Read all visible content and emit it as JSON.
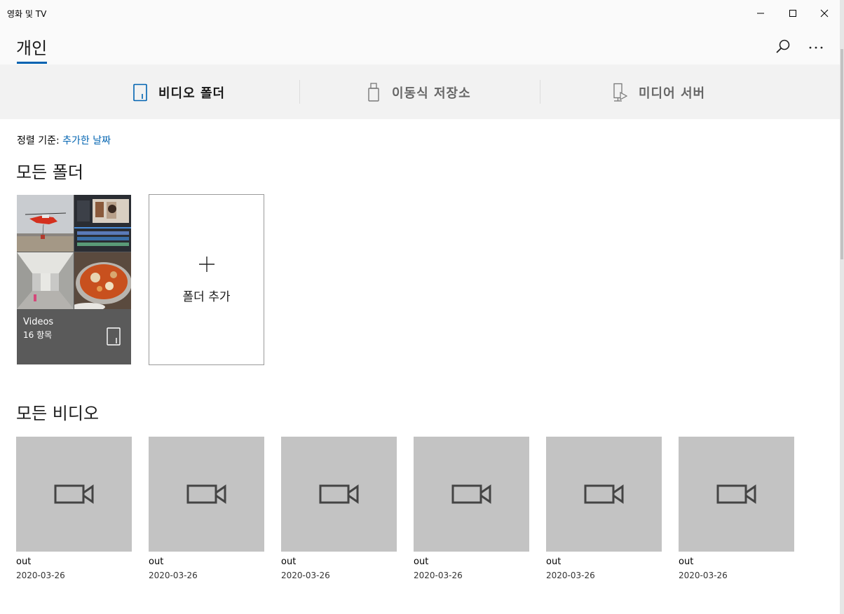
{
  "window": {
    "title": "영화 및 TV",
    "minimize_icon": "minimize-icon",
    "maximize_icon": "maximize-icon",
    "close_icon": "close-icon"
  },
  "header": {
    "title": "개인",
    "search_icon": "search-icon",
    "more_icon": "more-icon",
    "accent": "#0063b1"
  },
  "tabs": [
    {
      "label": "비디오 폴더",
      "icon": "video-folder-icon",
      "active": true
    },
    {
      "label": "이동식 저장소",
      "icon": "usb-drive-icon",
      "active": false
    },
    {
      "label": "미디어 서버",
      "icon": "media-server-icon",
      "active": false
    }
  ],
  "sort": {
    "label": "정렬 기준:",
    "value": "추가한 날짜"
  },
  "folders_section": {
    "title": "모든 폴더",
    "folder": {
      "name": "Videos",
      "count": "16 항목"
    },
    "add_folder_label": "폴더 추가"
  },
  "videos_section": {
    "title": "모든 비디오",
    "items": [
      {
        "title": "out",
        "date": "2020-03-26"
      },
      {
        "title": "out",
        "date": "2020-03-26"
      },
      {
        "title": "out",
        "date": "2020-03-26"
      },
      {
        "title": "out",
        "date": "2020-03-26"
      },
      {
        "title": "out",
        "date": "2020-03-26"
      },
      {
        "title": "out",
        "date": "2020-03-26"
      }
    ]
  }
}
